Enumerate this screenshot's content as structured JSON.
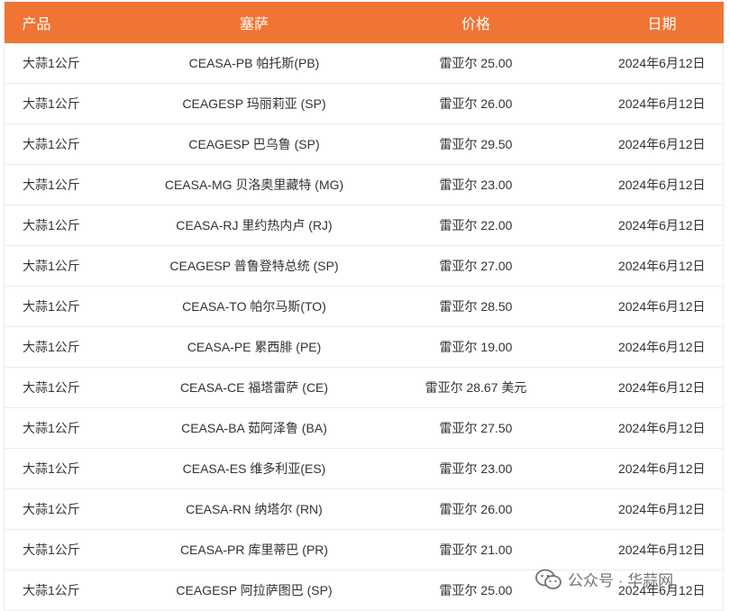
{
  "table": {
    "headers": [
      "产品",
      "塞萨",
      "价格",
      "日期"
    ],
    "rows": [
      [
        "大蒜1公斤",
        "CEASA-PB 帕托斯(PB)",
        "雷亚尔 25.00",
        "2024年6月12日"
      ],
      [
        "大蒜1公斤",
        "CEAGESP 玛丽莉亚 (SP)",
        "雷亚尔 26.00",
        "2024年6月12日"
      ],
      [
        "大蒜1公斤",
        "CEAGESP 巴乌鲁 (SP)",
        "雷亚尔 29.50",
        "2024年6月12日"
      ],
      [
        "大蒜1公斤",
        "CEASA-MG 贝洛奥里藏特 (MG)",
        "雷亚尔 23.00",
        "2024年6月12日"
      ],
      [
        "大蒜1公斤",
        "CEASA-RJ 里约热内卢 (RJ)",
        "雷亚尔 22.00",
        "2024年6月12日"
      ],
      [
        "大蒜1公斤",
        "CEAGESP 普鲁登特总统 (SP)",
        "雷亚尔 27.00",
        "2024年6月12日"
      ],
      [
        "大蒜1公斤",
        "CEASA-TO 帕尔马斯(TO)",
        "雷亚尔 28.50",
        "2024年6月12日"
      ],
      [
        "大蒜1公斤",
        "CEASA-PE 累西腓 (PE)",
        "雷亚尔 19.00",
        "2024年6月12日"
      ],
      [
        "大蒜1公斤",
        "CEASA-CE 福塔雷萨 (CE)",
        "雷亚尔 28.67 美元",
        "2024年6月12日"
      ],
      [
        "大蒜1公斤",
        "CEASA-BA 茹阿泽鲁 (BA)",
        "雷亚尔 27.50",
        "2024年6月12日"
      ],
      [
        "大蒜1公斤",
        "CEASA-ES 维多利亚(ES)",
        "雷亚尔 23.00",
        "2024年6月12日"
      ],
      [
        "大蒜1公斤",
        "CEASA-RN 纳塔尔 (RN)",
        "雷亚尔 26.00",
        "2024年6月12日"
      ],
      [
        "大蒜1公斤",
        "CEASA-PR 库里蒂巴 (PR)",
        "雷亚尔 21.00",
        "2024年6月12日"
      ],
      [
        "大蒜1公斤",
        "CEAGESP 阿拉萨图巴 (SP)",
        "雷亚尔 25.00",
        "2024年6月12日"
      ]
    ]
  },
  "watermark": {
    "text": "公众号 · 华蒜网",
    "icon": "wechat-icon"
  },
  "colors": {
    "header_bg": "#f07433",
    "header_text": "#ffffff",
    "border": "#ececec",
    "body_text": "#333333"
  }
}
